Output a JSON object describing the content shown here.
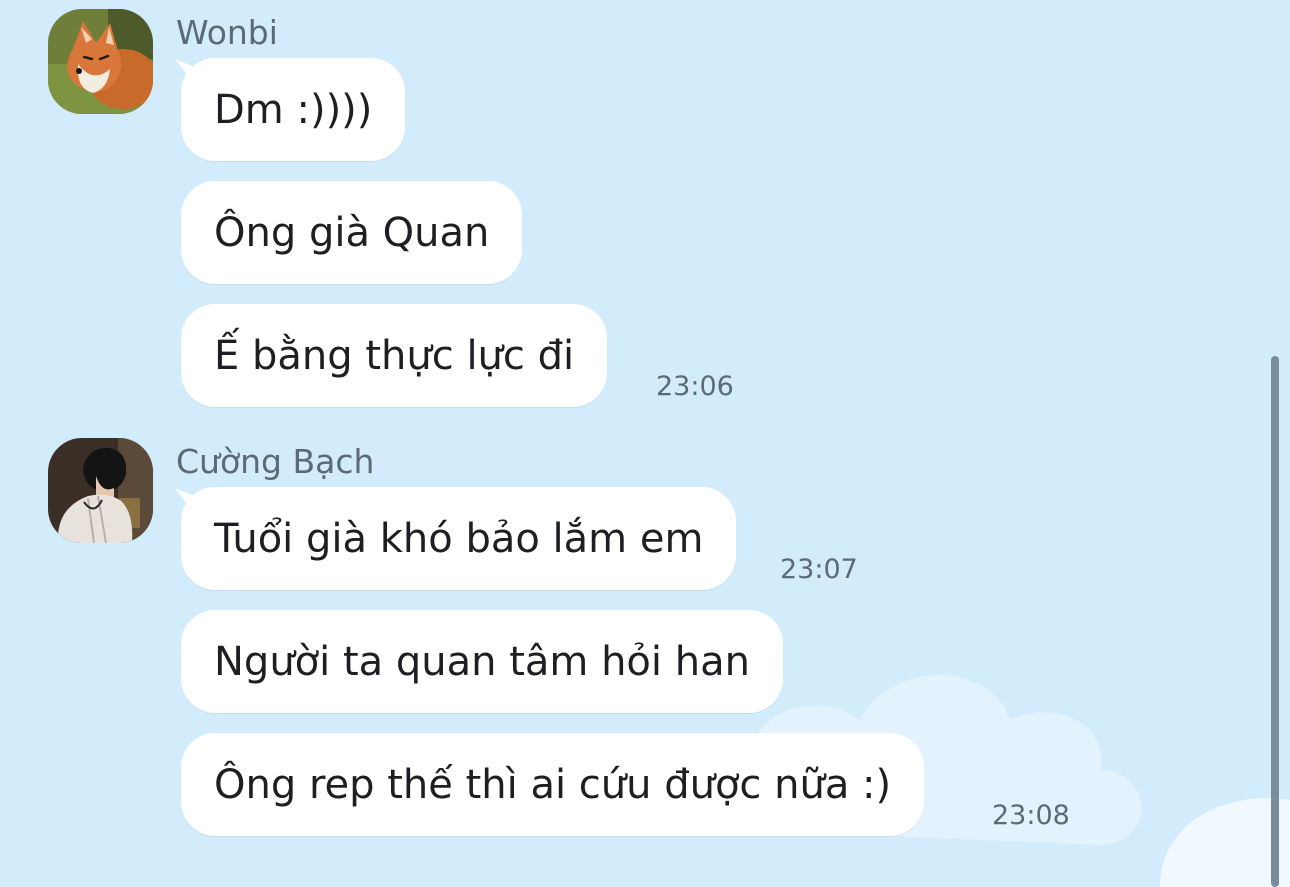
{
  "theme": {
    "background": "#d3ecfb",
    "bubble": "#ffffff",
    "meta_text": "#5a6a78",
    "message_text": "#1d1f22"
  },
  "groups": [
    {
      "sender": "Wonbi",
      "avatar_icon": "fox-photo-avatar",
      "messages": [
        {
          "text": "Dm :))))",
          "time": ""
        },
        {
          "text": "Ông già Quan",
          "time": ""
        },
        {
          "text": "Ế bằng thực lực đi",
          "time": "23:06"
        }
      ]
    },
    {
      "sender": "Cường Bạch",
      "avatar_icon": "person-photo-avatar",
      "messages": [
        {
          "text": "Tuổi già khó bảo lắm em",
          "time": "23:07"
        },
        {
          "text": "Người ta quan tâm hỏi han",
          "time": ""
        },
        {
          "text": "Ông rep thế thì ai cứu được nữa :)",
          "time": "23:08"
        }
      ]
    }
  ]
}
